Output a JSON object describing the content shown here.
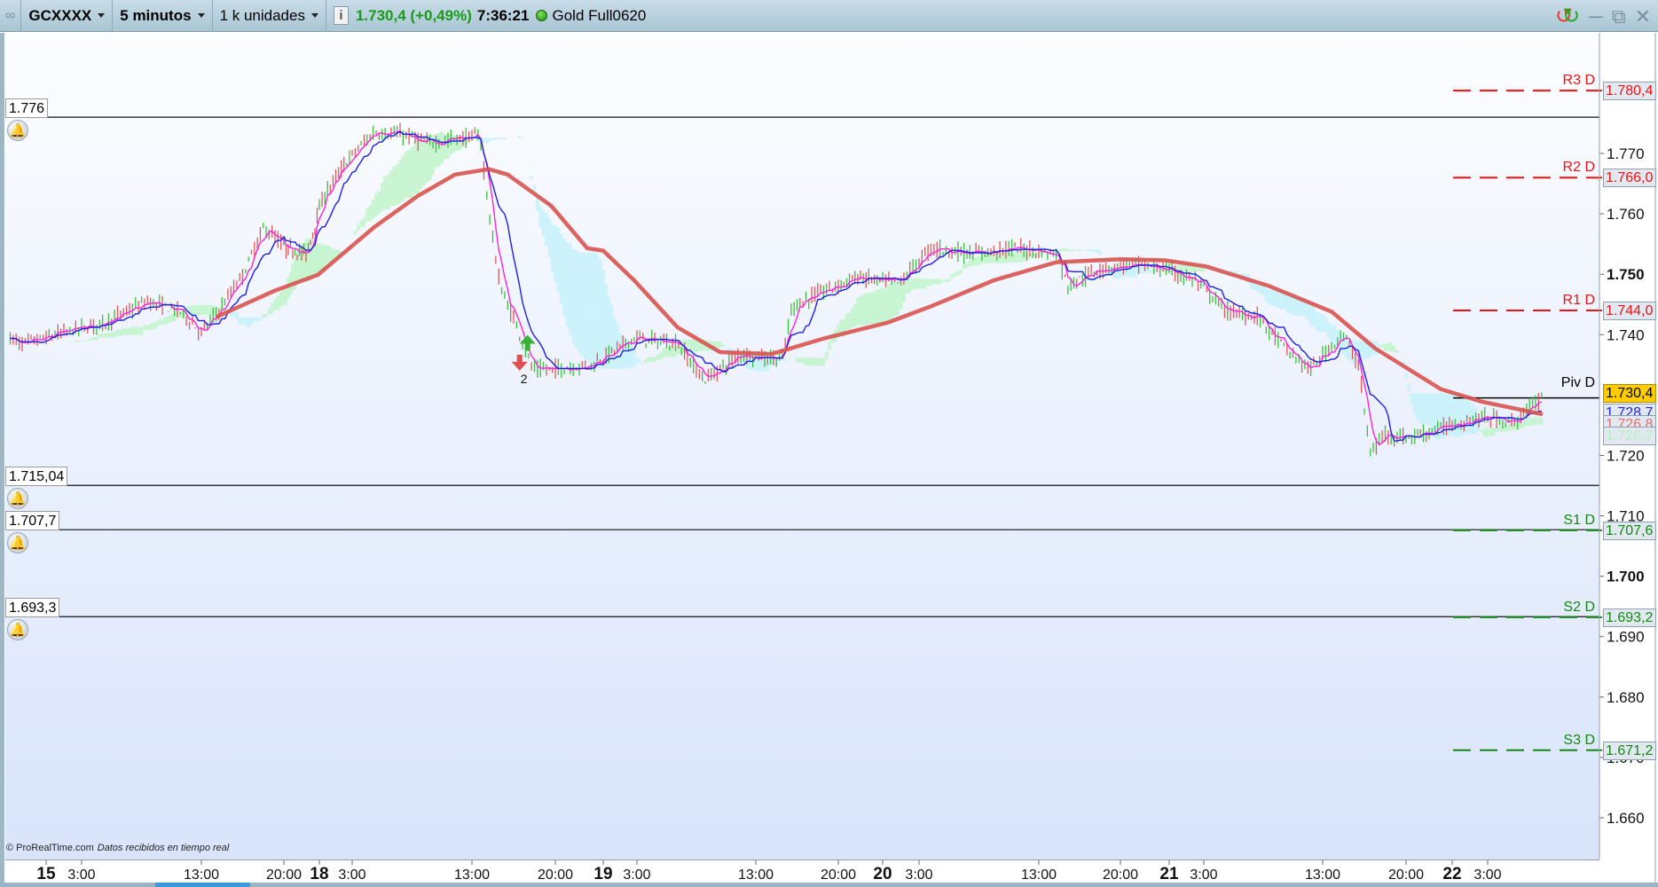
{
  "header": {
    "instrument": "GCXXXX",
    "timeframe": "5 minutos",
    "units": "1 k unidades",
    "last_price": "1.730,4 (+0,49%)",
    "time": "7:36:21",
    "status_color": "#2e9a1e",
    "feed": "Gold Full0620",
    "icons": [
      "link-icon",
      "info-icon",
      "refresh-arrows-icon",
      "minimize-icon",
      "restore-icon",
      "close-icon"
    ]
  },
  "colors": {
    "up_candle": "#3cc13c",
    "down_candle": "#e05a5a",
    "ma": "#d9534f",
    "kijun": "#1f1fe6",
    "tenkan": "#ff22dd",
    "cloud_bull": "#bff5c8",
    "cloud_bear": "#c4f2fb",
    "resistance": "#ee1111",
    "support": "#118811",
    "last_price_tag": "#ffcc00"
  },
  "footer": {
    "copyright": "© ProRealTime.com",
    "note": "Datos recibidos en tiempo real"
  },
  "alerts": [
    {
      "label": "1.776",
      "value": 1.776
    },
    {
      "label": "1.715,04",
      "value": 1.71504
    },
    {
      "label": "1.707,7",
      "value": 1.7077
    },
    {
      "label": "1.693,3",
      "value": 1.6933
    }
  ],
  "pivots": [
    {
      "name": "R3 D",
      "label": "1.780,4",
      "value": 1.7804,
      "kind": "resistance"
    },
    {
      "name": "R2 D",
      "label": "1.766,0",
      "value": 1.766,
      "kind": "resistance"
    },
    {
      "name": "R1 D",
      "label": "1.744,0",
      "value": 1.744,
      "kind": "resistance"
    },
    {
      "name": "Piv D",
      "label": "1.730,4",
      "value": 1.7304,
      "kind": "pivot"
    },
    {
      "name": "S1 D",
      "label": "1.707,6",
      "value": 1.7076,
      "kind": "support"
    },
    {
      "name": "S2 D",
      "label": "1.693,2",
      "value": 1.6932,
      "kind": "support"
    },
    {
      "name": "S3 D",
      "label": "1.671,2",
      "value": 1.6712,
      "kind": "support"
    }
  ],
  "indicator_tags": [
    {
      "label": "1.728,7",
      "color": "#1f1fe6"
    },
    {
      "label": "1.726,8",
      "color": "#e07070"
    },
    {
      "label": "1.726,7",
      "color": "#b8f0c0"
    }
  ],
  "signal_marker": {
    "label": "2",
    "time": "18 17:00"
  },
  "chart_data": {
    "type": "candlestick",
    "yaxis": {
      "ticks": [
        {
          "v": 1.77,
          "label": "1.770"
        },
        {
          "v": 1.76,
          "label": "1.760"
        },
        {
          "v": 1.75,
          "label": "1.750",
          "bold": true
        },
        {
          "v": 1.74,
          "label": "1.740"
        },
        {
          "v": 1.72,
          "label": "1.720"
        },
        {
          "v": 1.71,
          "label": "1.710"
        },
        {
          "v": 1.7,
          "label": "1.700",
          "bold": true
        },
        {
          "v": 1.69,
          "label": "1.690"
        },
        {
          "v": 1.68,
          "label": "1.680"
        },
        {
          "v": 1.67,
          "label": "1.670"
        },
        {
          "v": 1.66,
          "label": "1.660"
        }
      ]
    },
    "xaxis": {
      "ticks": [
        {
          "t": "15 00:00",
          "label": "15",
          "bold": true
        },
        {
          "t": "15 03:00",
          "label": "3:00"
        },
        {
          "t": "15 13:00",
          "label": "13:00"
        },
        {
          "t": "15 20:00",
          "label": "20:00"
        },
        {
          "t": "18 00:00",
          "label": "18",
          "bold": true
        },
        {
          "t": "18 03:00",
          "label": "3:00"
        },
        {
          "t": "18 13:00",
          "label": "13:00"
        },
        {
          "t": "18 20:00",
          "label": "20:00"
        },
        {
          "t": "19 00:00",
          "label": "19",
          "bold": true
        },
        {
          "t": "19 03:00",
          "label": "3:00"
        },
        {
          "t": "19 13:00",
          "label": "13:00"
        },
        {
          "t": "19 20:00",
          "label": "20:00"
        },
        {
          "t": "20 00:00",
          "label": "20",
          "bold": true
        },
        {
          "t": "20 03:00",
          "label": "3:00"
        },
        {
          "t": "20 13:00",
          "label": "13:00"
        },
        {
          "t": "20 20:00",
          "label": "20:00"
        },
        {
          "t": "21 00:00",
          "label": "21",
          "bold": true
        },
        {
          "t": "21 03:00",
          "label": "3:00"
        },
        {
          "t": "21 13:00",
          "label": "13:00"
        },
        {
          "t": "21 20:00",
          "label": "20:00"
        },
        {
          "t": "22 00:00",
          "label": "22",
          "bold": true
        },
        {
          "t": "22 03:00",
          "label": "3:00"
        }
      ]
    },
    "price_path": [
      [
        "14 21:00",
        1.7394
      ],
      [
        "14 22:00",
        1.7385
      ],
      [
        "15 01:30",
        1.7403
      ],
      [
        "15 05:00",
        1.742
      ],
      [
        "15 07:40",
        1.7447
      ],
      [
        "15 08:30",
        1.7455
      ],
      [
        "15 11:15",
        1.7438
      ],
      [
        "15 13:00",
        1.7403
      ],
      [
        "15 14:45",
        1.7447
      ],
      [
        "15 16:30",
        1.7499
      ],
      [
        "15 18:20",
        1.7578
      ],
      [
        "15 20:10",
        1.7543
      ],
      [
        "15 22:35",
        1.7534
      ],
      [
        "18 00:25",
        1.763
      ],
      [
        "18 02:40",
        1.7691
      ],
      [
        "18 04:50",
        1.7735
      ],
      [
        "18 07:30",
        1.773
      ],
      [
        "18 09:20",
        1.7717
      ],
      [
        "18 12:25",
        1.7726
      ],
      [
        "18 13:40",
        1.773
      ],
      [
        "18 14:25",
        1.7604
      ],
      [
        "18 15:20",
        1.7481
      ],
      [
        "18 17:10",
        1.7394
      ],
      [
        "18 18:05",
        1.7342
      ],
      [
        "18 19:40",
        1.7342
      ],
      [
        "18 23:00",
        1.735
      ],
      [
        "19 02:45",
        1.7394
      ],
      [
        "19 06:25",
        1.7385
      ],
      [
        "19 08:40",
        1.7324
      ],
      [
        "19 11:40",
        1.7368
      ],
      [
        "19 15:15",
        1.7359
      ],
      [
        "19 16:05",
        1.7447
      ],
      [
        "19 18:50",
        1.7473
      ],
      [
        "19 21:40",
        1.7495
      ],
      [
        "20 01:20",
        1.7485
      ],
      [
        "20 04:00",
        1.7543
      ],
      [
        "20 07:30",
        1.7534
      ],
      [
        "20 11:00",
        1.7543
      ],
      [
        "20 14:30",
        1.7534
      ],
      [
        "20 15:30",
        1.7481
      ],
      [
        "20 18:10",
        1.7508
      ],
      [
        "20 21:00",
        1.7517
      ],
      [
        "20 23:40",
        1.7508
      ],
      [
        "21 02:15",
        1.749
      ],
      [
        "21 05:00",
        1.7438
      ],
      [
        "21 07:35",
        1.7429
      ],
      [
        "21 10:15",
        1.7368
      ],
      [
        "21 12:00",
        1.7342
      ],
      [
        "21 14:40",
        1.7403
      ],
      [
        "21 16:00",
        1.735
      ],
      [
        "21 17:00",
        1.7202
      ],
      [
        "21 18:15",
        1.7237
      ],
      [
        "21 20:00",
        1.7228
      ],
      [
        "21 23:00",
        1.7245
      ],
      [
        "22 02:30",
        1.7263
      ],
      [
        "22 05:10",
        1.7254
      ],
      [
        "22 07:35",
        1.7298
      ]
    ],
    "moving_average": [
      [
        "15 14:15",
        1.7429
      ],
      [
        "15 19:15",
        1.7473
      ],
      [
        "15 23:50",
        1.7499
      ],
      [
        "18 04:50",
        1.7578
      ],
      [
        "18 08:30",
        1.763
      ],
      [
        "18 11:35",
        1.7665
      ],
      [
        "18 14:25",
        1.7674
      ],
      [
        "18 16:00",
        1.7665
      ],
      [
        "18 19:40",
        1.7613
      ],
      [
        "18 22:40",
        1.7543
      ],
      [
        "19 00:00",
        1.7539
      ],
      [
        "19 02:45",
        1.749
      ],
      [
        "19 06:25",
        1.7412
      ],
      [
        "19 10:00",
        1.7371
      ],
      [
        "19 14:20",
        1.7368
      ],
      [
        "19 18:50",
        1.7394
      ],
      [
        "20 00:25",
        1.742
      ],
      [
        "20 04:00",
        1.7447
      ],
      [
        "20 09:15",
        1.749
      ],
      [
        "20 14:30",
        1.752
      ],
      [
        "20 20:00",
        1.7525
      ],
      [
        "20 23:40",
        1.7523
      ],
      [
        "21 03:10",
        1.7513
      ],
      [
        "21 08:25",
        1.7481
      ],
      [
        "21 13:45",
        1.7438
      ],
      [
        "21 17:25",
        1.7377
      ],
      [
        "21 23:00",
        1.731
      ],
      [
        "22 02:30",
        1.7289
      ],
      [
        "22 07:35",
        1.7268
      ]
    ]
  }
}
